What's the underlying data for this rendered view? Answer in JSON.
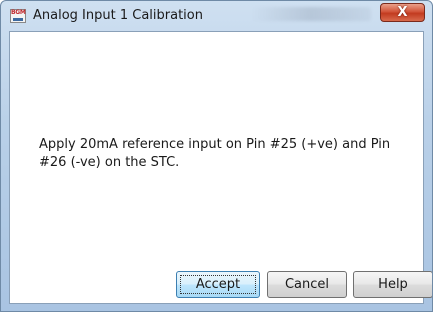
{
  "window": {
    "title": "Analog Input 1 Calibration",
    "icon": "bgm-logo-icon",
    "icon_text": "BGM",
    "close_icon": "close-icon",
    "close_glyph": "X"
  },
  "dialog": {
    "message": "Apply 20mA reference input on Pin #25 (+ve) and Pin #26 (-ve) on the STC."
  },
  "buttons": {
    "accept": "Accept",
    "cancel": "Cancel",
    "help": "Help"
  },
  "colors": {
    "titlebar": "#b9d0e8",
    "close_button": "#c23b20",
    "default_button": "#bee6fd"
  }
}
